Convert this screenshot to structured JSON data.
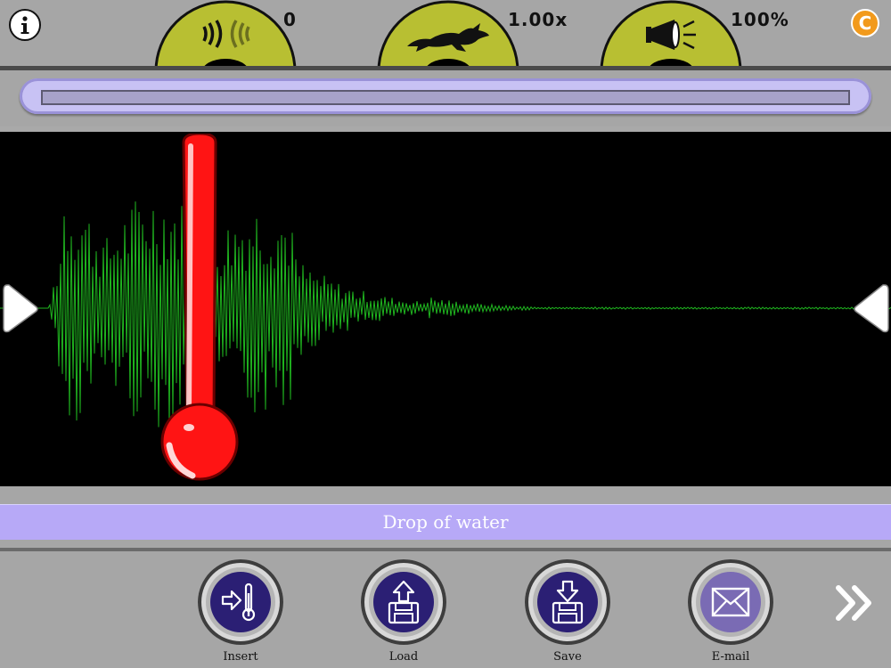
{
  "toolbar": {
    "info_icon": "info-icon",
    "credits_label": "C",
    "pitch": {
      "icon": "sound-waves-icon",
      "value": "0"
    },
    "speed": {
      "icon": "running-rabbit-icon",
      "value": "1.00x"
    },
    "volume": {
      "icon": "loudspeaker-icon",
      "value": "100%"
    }
  },
  "playback": {
    "progress": 0
  },
  "sound": {
    "name": "Drop of water"
  },
  "thermometer": {
    "icon": "thermometer-icon"
  },
  "buttons": {
    "insert": "Insert",
    "load": "Load",
    "save": "Save",
    "email": "E-mail",
    "next_icon": "double-chevron-right-icon"
  },
  "colors": {
    "dial": "#b8bf32",
    "accent": "#b7a9f7",
    "waveform": "#1fb51f",
    "thermometer": "#ff1414",
    "button_core": "#2b1f74",
    "credits": "#f29a1c"
  }
}
